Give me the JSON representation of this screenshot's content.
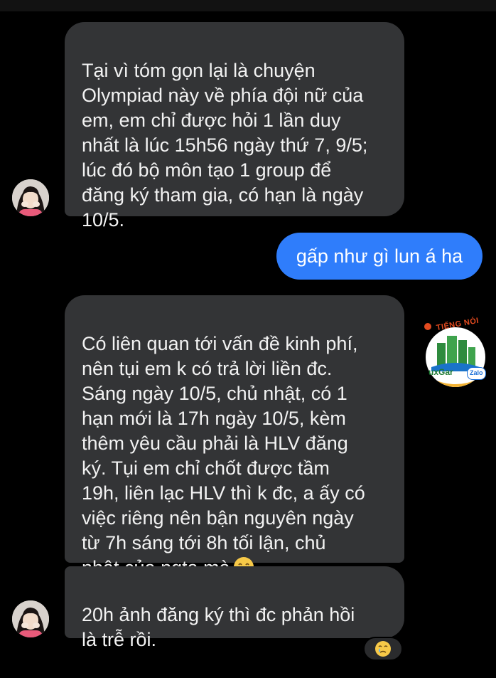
{
  "messages": [
    {
      "side": "received",
      "text": "Tại vì tóm gọn lại là chuyện\nOlympiad này về phía đội nữ của\nem, em chỉ được hỏi 1 lần duy\nnhất là lúc 15h56 ngày thứ 7, 9/5;\nlúc đó bộ môn tạo 1 group để\nđăng ký tham gia, có hạn là ngày\n10/5."
    },
    {
      "side": "sent",
      "text": "gấp như gì lun á ha"
    },
    {
      "side": "received",
      "text": "Có liên quan tới vấn đề kinh phí,\nnên tụi em k có trả lời liền đc.\nSáng ngày 10/5, chủ nhật, có 1\nhạn mới là 17h ngày 10/5, kèm\nthêm yêu cầu phải là HLV đăng\nký. Tụi em chỉ chốt được tầm\n19h, liên lạc HLV thì k đc, a ấy có\nviệc riêng nên bận nguyên ngày\ntừ 7h sáng tới 8h tối lận, chủ\nnhật của ngta mà",
      "trailing_emoji": "smiling-face-with-tear"
    },
    {
      "side": "received",
      "text": "20h ảnh đăng ký thì đc phản hồi\nlà trễ rồi.",
      "reaction": "crying-face"
    }
  ],
  "watermark": {
    "top_text": "TIẾNG NÓI",
    "brand_text": "uxGar",
    "badge_text": "Zalo"
  },
  "colors": {
    "background": "#000000",
    "received_bubble": "#333436",
    "sent_bubble": "#2f7dfb"
  }
}
